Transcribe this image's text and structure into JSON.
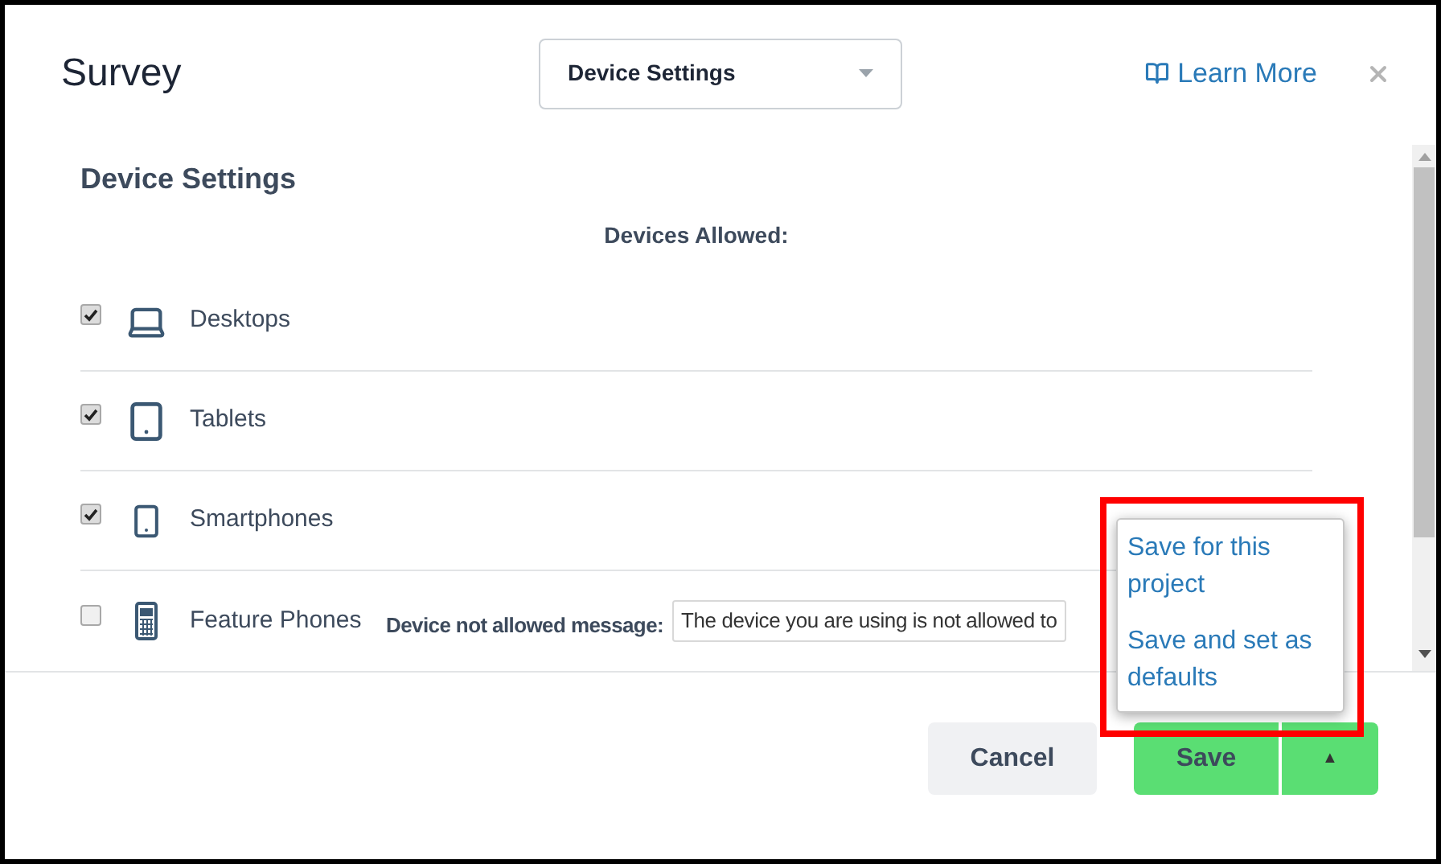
{
  "dialog": {
    "title": "Survey",
    "section_select": {
      "value": "Device Settings"
    },
    "learn_more": "Learn More"
  },
  "section": {
    "heading": "Device Settings",
    "subheading": "Devices Allowed:"
  },
  "devices": [
    {
      "kind": "laptop",
      "label": "Desktops",
      "checked": true
    },
    {
      "kind": "tablet",
      "label": "Tablets",
      "checked": true
    },
    {
      "kind": "smartphone",
      "label": "Smartphones",
      "checked": true
    },
    {
      "kind": "featurephone",
      "label": "Feature Phones",
      "checked": false,
      "message_label": "Device not allowed message:",
      "message_value": "The device you are using is not allowed to"
    }
  ],
  "save_menu": {
    "items": [
      "Save for this project",
      "Save and set as defaults"
    ]
  },
  "footer": {
    "cancel": "Cancel",
    "save": "Save",
    "caret": "▲"
  }
}
